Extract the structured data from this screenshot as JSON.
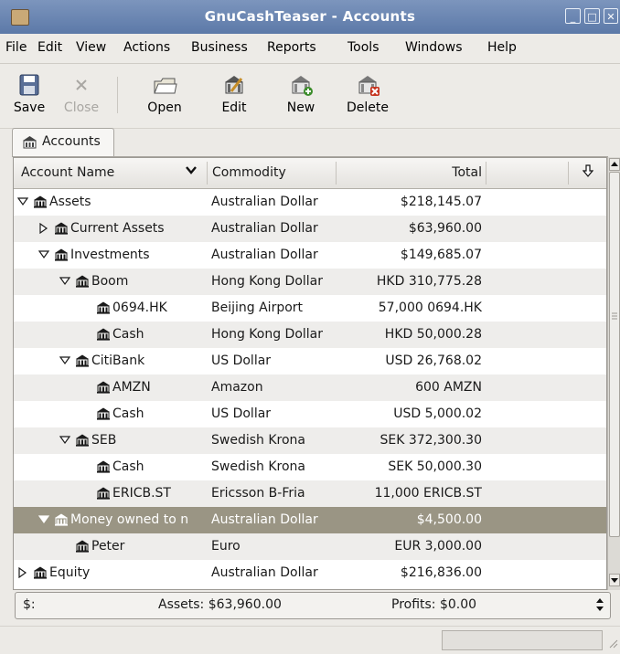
{
  "window": {
    "title": "GnuCashTeaser - Accounts"
  },
  "menubar": {
    "items": [
      "File",
      "Edit",
      "View",
      "Actions",
      "Business",
      "Reports",
      "Tools",
      "Windows",
      "Help"
    ]
  },
  "toolbar": {
    "save_label": "Save",
    "close_label": "Close",
    "open_label": "Open",
    "edit_label": "Edit",
    "new_label": "New",
    "delete_label": "Delete"
  },
  "tab": {
    "label": "Accounts"
  },
  "columns": {
    "name": "Account Name",
    "commodity": "Commodity",
    "total": "Total"
  },
  "rows": [
    {
      "name": "Assets",
      "commodity": "Australian Dollar",
      "total": "$218,145.07",
      "level": 0,
      "expander": "expanded"
    },
    {
      "name": "Current Assets",
      "commodity": "Australian Dollar",
      "total": "$63,960.00",
      "level": 1,
      "expander": "collapsed"
    },
    {
      "name": "Investments",
      "commodity": "Australian Dollar",
      "total": "$149,685.07",
      "level": 1,
      "expander": "expanded"
    },
    {
      "name": "Boom",
      "commodity": "Hong Kong Dollar",
      "total": "HKD 310,775.28",
      "level": 2,
      "expander": "expanded"
    },
    {
      "name": "0694.HK",
      "commodity": "Beijing Airport",
      "total": "57,000 0694.HK",
      "level": 3,
      "expander": "none"
    },
    {
      "name": "Cash",
      "commodity": "Hong Kong Dollar",
      "total": "HKD 50,000.28",
      "level": 3,
      "expander": "none"
    },
    {
      "name": "CitiBank",
      "commodity": "US Dollar",
      "total": "USD 26,768.02",
      "level": 2,
      "expander": "expanded"
    },
    {
      "name": "AMZN",
      "commodity": "Amazon",
      "total": "600 AMZN",
      "level": 3,
      "expander": "none"
    },
    {
      "name": "Cash",
      "commodity": "US Dollar",
      "total": "USD 5,000.02",
      "level": 3,
      "expander": "none"
    },
    {
      "name": "SEB",
      "commodity": "Swedish Krona",
      "total": "SEK 372,300.30",
      "level": 2,
      "expander": "expanded"
    },
    {
      "name": "Cash",
      "commodity": "Swedish Krona",
      "total": "SEK 50,000.30",
      "level": 3,
      "expander": "none"
    },
    {
      "name": "ERICB.ST",
      "commodity": "Ericsson B-Fria",
      "total": "11,000 ERICB.ST",
      "level": 3,
      "expander": "none"
    },
    {
      "name": "Money owned to n",
      "commodity": "Australian Dollar",
      "total": "$4,500.00",
      "level": 1,
      "expander": "expanded",
      "selected": true
    },
    {
      "name": "Peter",
      "commodity": "Euro",
      "total": "EUR 3,000.00",
      "level": 2,
      "expander": "none"
    },
    {
      "name": "Equity",
      "commodity": "Australian Dollar",
      "total": "$216,836.00",
      "level": 0,
      "expander": "collapsed"
    }
  ],
  "summary": {
    "currency": "$:",
    "assets": "Assets: $63,960.00",
    "profits": "Profits: $0.00"
  },
  "colors": {
    "titlebar": "#6b86b3",
    "selection": "#9a9584",
    "odd_row": "#eeedeb"
  },
  "icons": {
    "account": "bank-icon",
    "save": "floppy-icon",
    "close": "close-icon",
    "open": "open-folder-icon",
    "edit": "edit-account-icon",
    "new": "new-account-icon",
    "delete": "delete-account-icon",
    "column_menu": "chevron-down-icon",
    "column_select": "down-arrow-icon"
  }
}
